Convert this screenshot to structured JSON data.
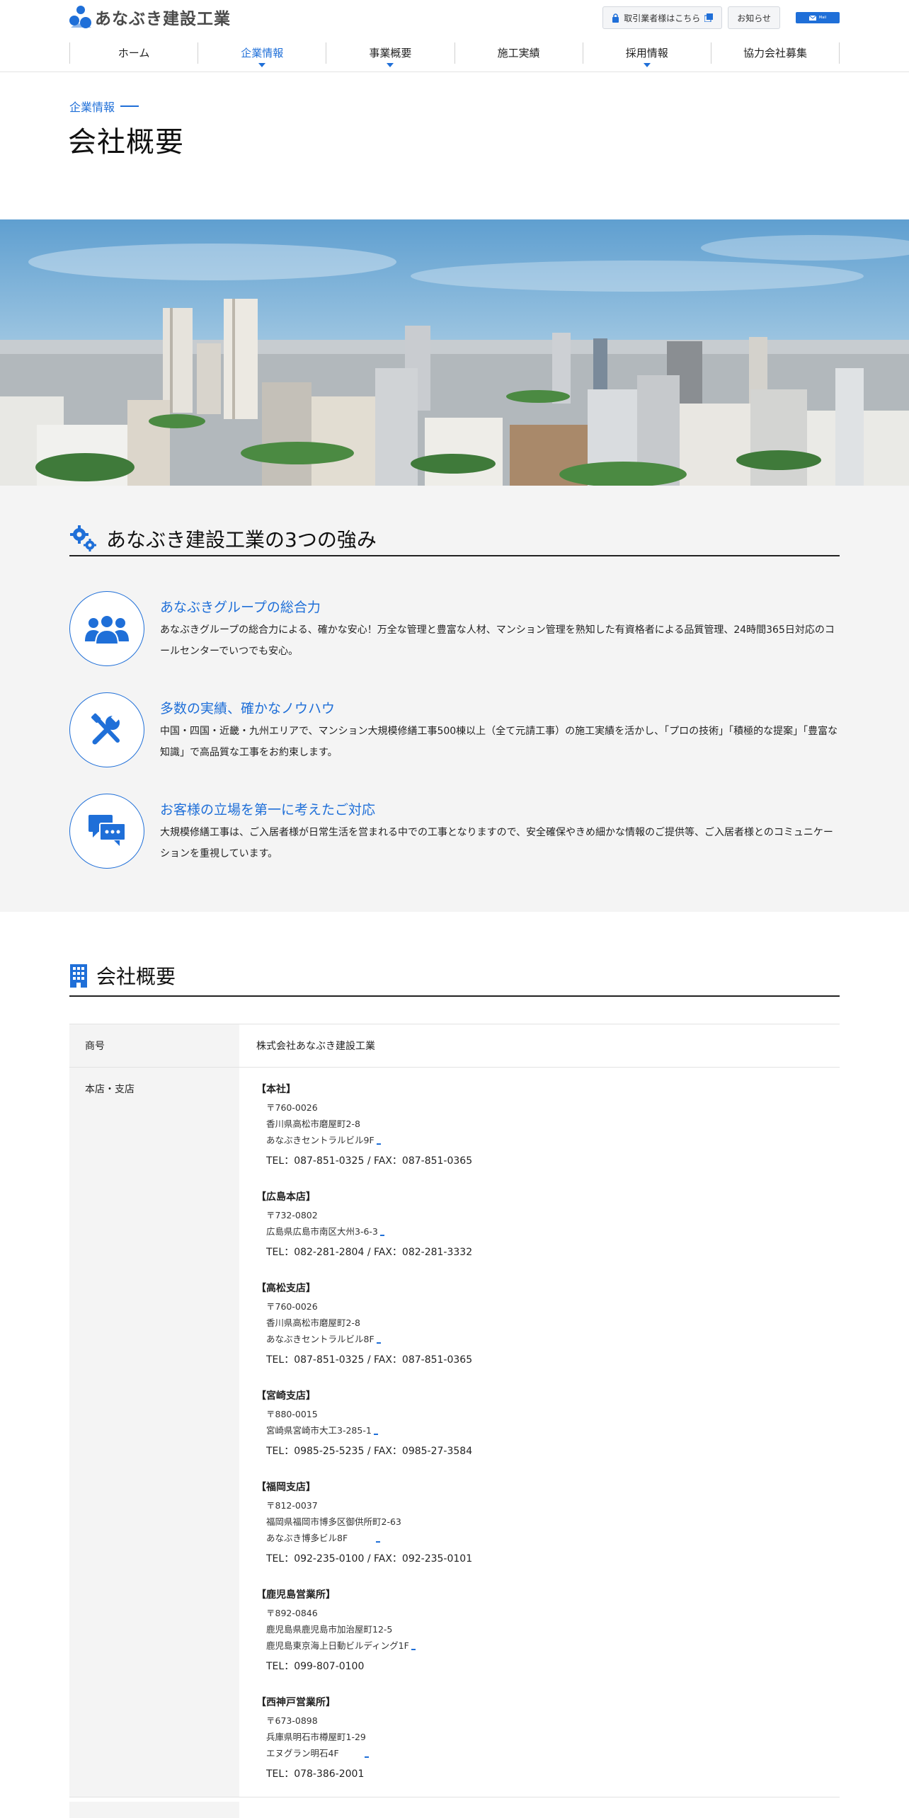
{
  "header": {
    "logo_text": "あなぶき建設工業",
    "partner_login": "取引業者様はこちら",
    "news": "お知らせ",
    "mail_label": "Mail"
  },
  "nav": [
    {
      "label": "ホーム",
      "active": false,
      "caret": false
    },
    {
      "label": "企業情報",
      "active": true,
      "caret": true
    },
    {
      "label": "事業概要",
      "active": false,
      "caret": true
    },
    {
      "label": "施工実績",
      "active": false,
      "caret": false
    },
    {
      "label": "採用情報",
      "active": false,
      "caret": true
    },
    {
      "label": "協力会社募集",
      "active": false,
      "caret": false
    }
  ],
  "page": {
    "breadcrumb": "企業情報",
    "title": "会社概要"
  },
  "strengths": {
    "heading": "あなぶき建設工業の3つの強み",
    "items": [
      {
        "icon": "group-icon",
        "title": "あなぶきグループの総合力",
        "text": "あなぶきグループの総合力による、確かな安心！万全な管理と豊富な人材、マンション管理を熟知した有資格者による品質管理、24時間365日対応のコールセンターでいつでも安心。"
      },
      {
        "icon": "tools-icon",
        "title": "多数の実績、確かなノウハウ",
        "text": "中国・四国・近畿・九州エリアで、マンション大規模修繕工事500棟以上（全て元請工事）の施工実績を活かし、「プロの技術」「積極的な提案」「豊富な知識」で高品質な工事をお約束します。"
      },
      {
        "icon": "chat-icon",
        "title": "お客様の立場を第一に考えたご対応",
        "text": "大規模修繕工事は、ご入居者様が日常生活を営まれる中での工事となりますので、安全確保やきめ細かな情報のご提供等、ご入居者様とのコミュニケーションを重視しています。"
      }
    ]
  },
  "overview": {
    "heading": "会社概要",
    "trade_name_label": "商号",
    "trade_name": "株式会社あなぶき建設工業",
    "offices_label": "本店・支店",
    "offices": [
      {
        "name": "【本社】",
        "postal": "〒760-0026",
        "address": [
          "香川県高松市磨屋町2-8",
          "あなぶきセントラルビル9F"
        ],
        "tel": "TEL：087-851-0325 / FAX：087-851-0365"
      },
      {
        "name": "【広島本店】",
        "postal": "〒732-0802",
        "address": [
          "広島県広島市南区大州3-6-3"
        ],
        "tel": "TEL：082-281-2804 / FAX：082-281-3332"
      },
      {
        "name": "【高松支店】",
        "postal": "〒760-0026",
        "address": [
          "香川県高松市磨屋町2-8",
          "あなぶきセントラルビル8F"
        ],
        "tel": "TEL：087-851-0325 / FAX：087-851-0365"
      },
      {
        "name": "【宮崎支店】",
        "postal": "〒880-0015",
        "address": [
          "宮崎県宮崎市大工3-285-1"
        ],
        "tel": "TEL：0985-25-5235 / FAX：0985-27-3584"
      },
      {
        "name": "【福岡支店】",
        "postal": "〒812-0037",
        "address": [
          "福岡県福岡市博多区御供所町2-63",
          "あなぶき博多ビル8F"
        ],
        "tel": "TEL：092-235-0100 / FAX：092-235-0101"
      },
      {
        "name": "【鹿児島営業所】",
        "postal": "〒892-0846",
        "address": [
          "鹿児島県鹿児島市加治屋町12-5",
          "鹿児島東京海上日動ビルディング1F"
        ],
        "tel": "TEL：099-807-0100"
      },
      {
        "name": "【西神戸営業所】",
        "postal": "〒673-0898",
        "address": [
          "兵庫県明石市樽屋町1-29",
          "エヌグラン明石4F"
        ],
        "tel": "TEL：078-386-2001"
      }
    ]
  },
  "colors": {
    "accent": "#1f6fd8",
    "band": "#f4f4f4"
  }
}
